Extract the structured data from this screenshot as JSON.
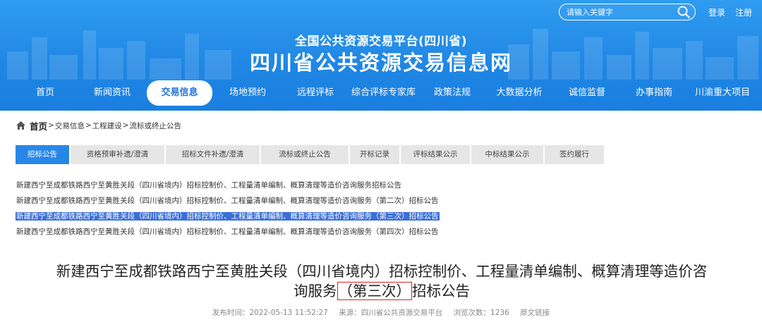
{
  "header": {
    "search_placeholder": "请输入关键字",
    "login": "登录",
    "register": "注册",
    "subtitle": "全国公共资源交易平台(四川省)",
    "title": "四川省公共资源交易信息网"
  },
  "nav": [
    {
      "label": "首页",
      "active": false
    },
    {
      "label": "新闻资讯",
      "active": false
    },
    {
      "label": "交易信息",
      "active": true
    },
    {
      "label": "场地预约",
      "active": false
    },
    {
      "label": "远程评标",
      "active": false
    },
    {
      "label": "综合评标专家库",
      "active": false
    },
    {
      "label": "政策法规",
      "active": false
    },
    {
      "label": "大数据分析",
      "active": false
    },
    {
      "label": "诚信监督",
      "active": false
    },
    {
      "label": "办事指南",
      "active": false
    },
    {
      "label": "川渝重大项目",
      "active": false
    }
  ],
  "breadcrumb": {
    "home": "首页",
    "items": [
      "交易信息",
      "工程建设",
      "流标或终止公告"
    ],
    "separator": ">"
  },
  "tabs": [
    {
      "label": "招标公告",
      "active": true
    },
    {
      "label": "资格预审补遗/澄清",
      "active": false
    },
    {
      "label": "招标文件补遗/澄清",
      "active": false
    },
    {
      "label": "流标或终止公告",
      "active": false
    },
    {
      "label": "开标记录",
      "active": false
    },
    {
      "label": "评标结果公示",
      "active": false
    },
    {
      "label": "中标结果公示",
      "active": false
    },
    {
      "label": "签约履行",
      "active": false
    }
  ],
  "list": [
    {
      "text": "新建西宁至成都铁路西宁至黄胜关段（四川省境内）招标控制价、工程量清单编制、概算清理等造价咨询服务招标公告",
      "selected": false
    },
    {
      "text": "新建西宁至成都铁路西宁至黄胜关段（四川省境内）招标控制价、工程量清单编制、概算清理等造价咨询服务（第二次）招标公告",
      "selected": false
    },
    {
      "text": "新建西宁至成都铁路西宁至黄胜关段（四川省境内）招标控制价、工程量清单编制、概算清理等造价咨询服务（第三次）招标公告",
      "selected": true
    },
    {
      "text": "新建西宁至成都铁路西宁至黄胜关段（四川省境内）招标控制价、工程量清单编制、概算清理等造价咨询服务（第四次）招标公告",
      "selected": false
    }
  ],
  "article": {
    "title_line1": "新建西宁至成都铁路西宁至黄胜关段（四川省境内）招标控制价、工程量清单编制、概算清理等造价咨",
    "title_line2_pre": "询服务",
    "title_line2_highlight": "（第三次）",
    "title_line2_post": "招标公告",
    "publish_time": "发布时间：2022-05-13 11:52:27",
    "source": "来源：四川省公共资源交易平台",
    "views": "浏览次数：1236",
    "original_link": "原文链接"
  },
  "colors": {
    "header_blue": "#1f86e4",
    "tab_active": "#2887e6",
    "selection": "#3a6fd8",
    "highlight_border": "#e0201d"
  }
}
